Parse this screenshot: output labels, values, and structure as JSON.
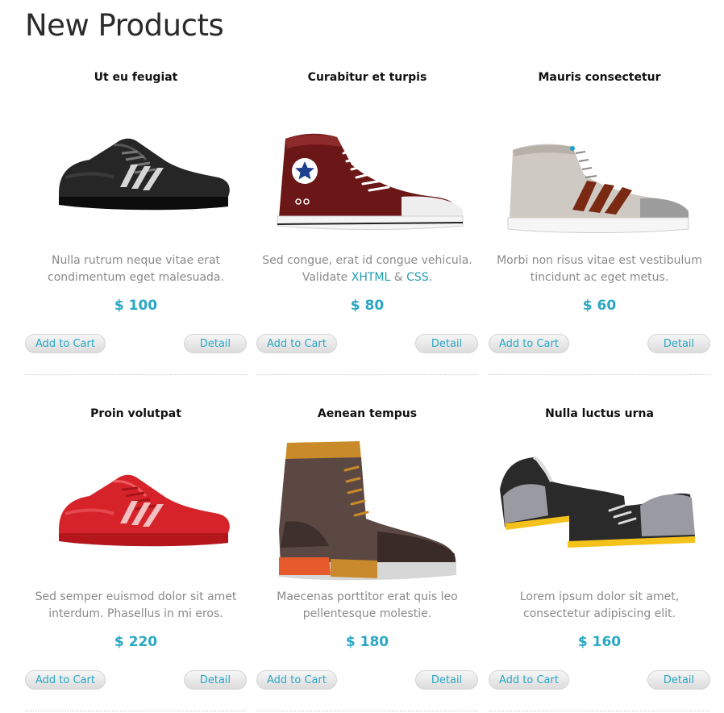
{
  "page": {
    "title": "New Products"
  },
  "buttons": {
    "add_to_cart": "Add to Cart",
    "detail": "Detail"
  },
  "products": [
    {
      "name": "Ut eu feugiat",
      "description": "Nulla rutrum neque vitae erat condimentum eget malesuada.",
      "price": "$ 100",
      "image": "black-sneaker-image"
    },
    {
      "name": "Curabitur et turpis",
      "description_prefix": "Sed congue, erat id congue vehicula. Validate ",
      "link1": "XHTML",
      "amp": " & ",
      "link2": "CSS",
      "suffix": ".",
      "price": "$ 80",
      "image": "maroon-high-top-image"
    },
    {
      "name": "Mauris consectetur",
      "description": "Morbi non risus vitae est vestibulum tincidunt ac eget metus.",
      "price": "$ 60",
      "image": "beige-high-top-image"
    },
    {
      "name": "Proin volutpat",
      "description": "Sed semper euismod dolor sit amet interdum. Phasellus in mi eros.",
      "price": "$ 220",
      "image": "red-sneaker-image"
    },
    {
      "name": "Aenean tempus",
      "description": "Maecenas porttitor erat quis leo pellentesque molestie.",
      "price": "$ 180",
      "image": "brown-boot-image"
    },
    {
      "name": "Nulla luctus urna",
      "description": "Lorem ipsum dolor sit amet, consectetur adipiscing elit.",
      "price": "$ 160",
      "image": "basketball-shoes-image"
    }
  ],
  "colors": {
    "accent": "#2aa7c4",
    "text_muted": "#8a8a8a",
    "title": "#2b2b2b"
  }
}
